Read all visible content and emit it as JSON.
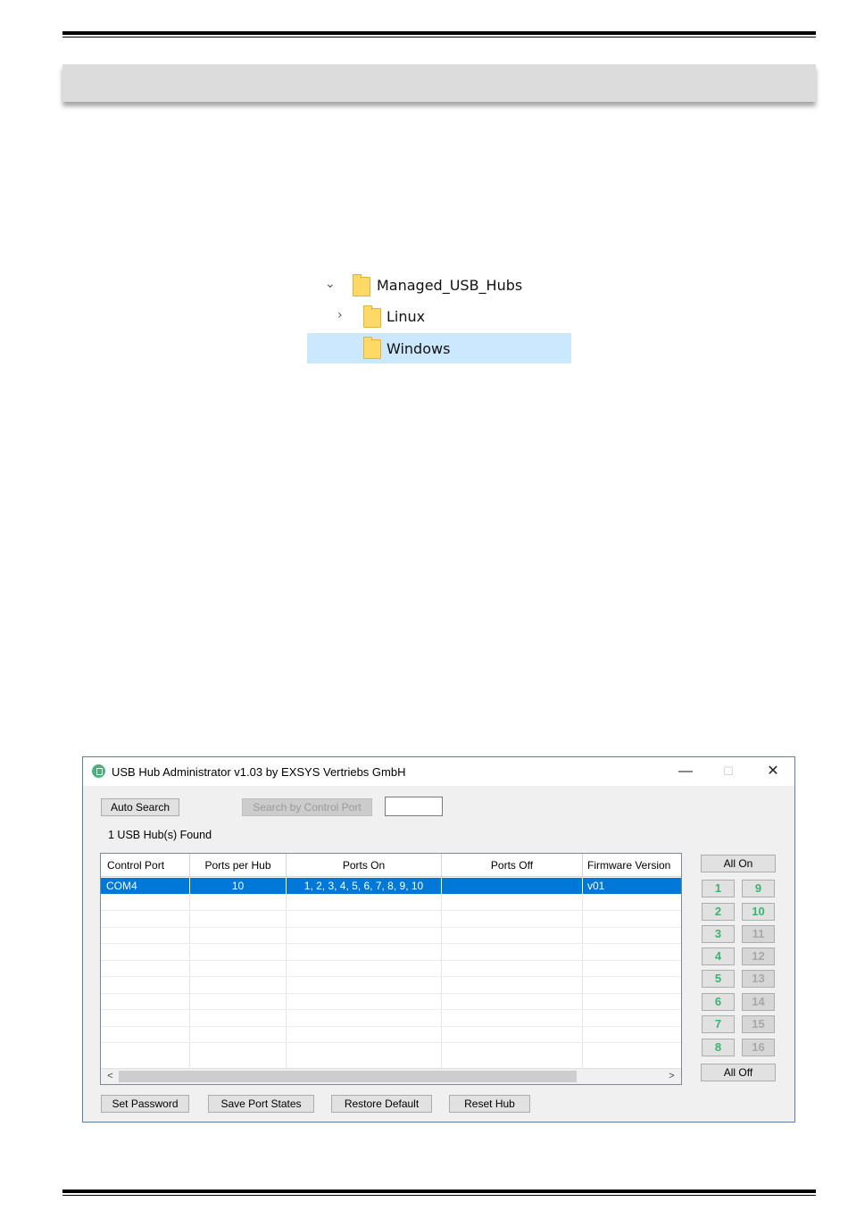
{
  "tree": {
    "items": [
      {
        "label": "Managed_USB_Hubs",
        "expanded": true
      },
      {
        "label": "Linux",
        "expanded": false
      },
      {
        "label": "Windows",
        "selected": true
      }
    ]
  },
  "window": {
    "title": "USB Hub Administrator v1.03 by EXSYS Vertriebs GmbH",
    "controls": {
      "minimize": "—",
      "maximize": "☐",
      "close": "✕"
    },
    "auto_search": "Auto Search",
    "search_by_port": "Search by Control Port",
    "search_value": "",
    "found": "1 USB Hub(s) Found",
    "columns": [
      "Control Port",
      "Ports per Hub",
      "Ports On",
      "Ports Off",
      "Firmware Version"
    ],
    "rows": [
      {
        "control_port": "COM4",
        "ports_per_hub": "10",
        "ports_on": "1, 2, 3, 4, 5, 6, 7, 8, 9, 10",
        "ports_off": "",
        "firmware": "v01"
      }
    ],
    "scroll_left": "<",
    "scroll_right": ">",
    "all_on": "All On",
    "all_off": "All Off",
    "ports_col1": [
      "1",
      "2",
      "3",
      "4",
      "5",
      "6",
      "7",
      "8"
    ],
    "ports_col2": [
      "9",
      "10",
      "11",
      "12",
      "13",
      "14",
      "15",
      "16"
    ],
    "port_color_on": "#3cb371",
    "port_color_off": "#a8a8a8",
    "bottom_buttons": {
      "set_password": "Set Password",
      "save_port_states": "Save Port States",
      "restore_default": "Restore Default",
      "reset_hub": "Reset Hub"
    }
  }
}
